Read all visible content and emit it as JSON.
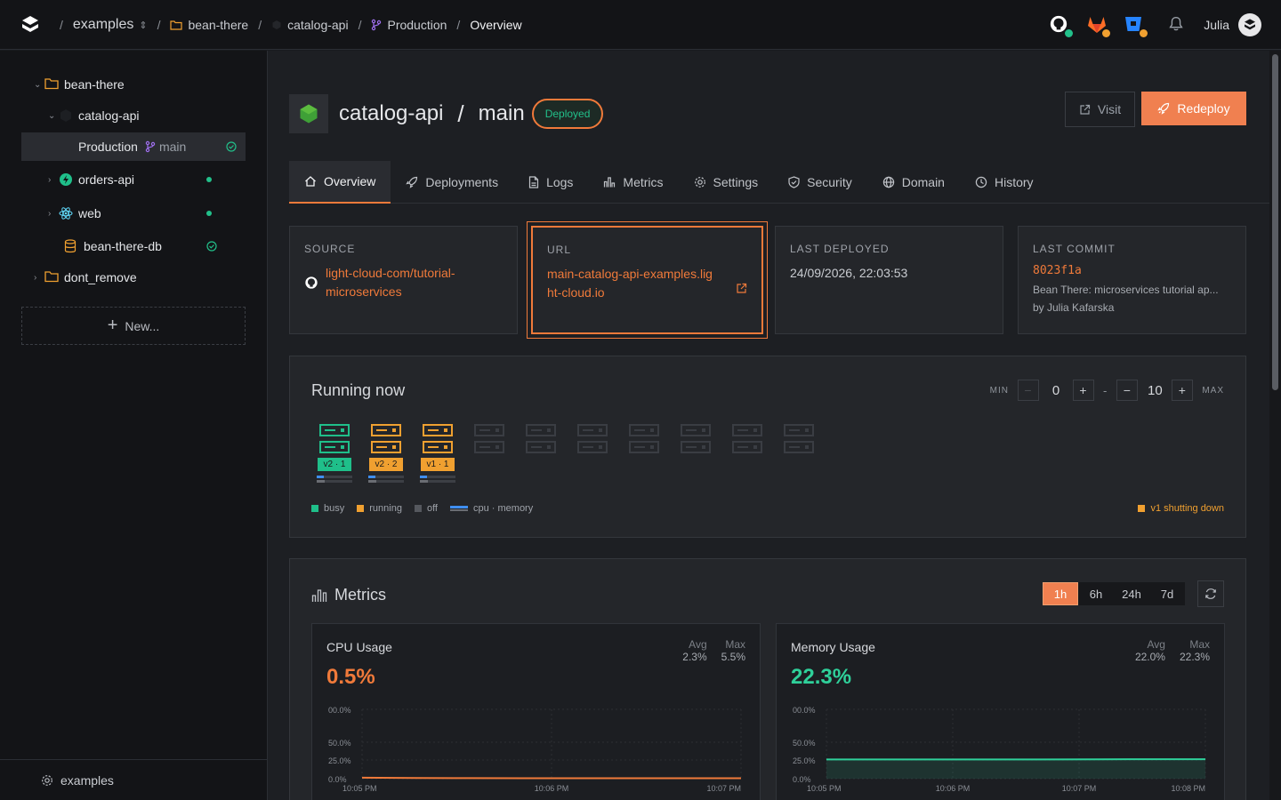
{
  "topbar": {
    "crumbs": [
      {
        "label": "examples"
      },
      {
        "label": "bean-there"
      },
      {
        "label": "catalog-api"
      },
      {
        "label": "Production"
      },
      {
        "label": "Overview"
      }
    ],
    "user_name": "Julia"
  },
  "sidebar": {
    "items": [
      {
        "label": "bean-there"
      },
      {
        "label": "catalog-api"
      },
      {
        "label": "Production",
        "branch": "main"
      },
      {
        "label": "orders-api"
      },
      {
        "label": "web"
      },
      {
        "label": "bean-there-db"
      },
      {
        "label": "dont_remove"
      }
    ],
    "new_label": "New...",
    "footer_label": "examples"
  },
  "header": {
    "service": "catalog-api",
    "branch": "main",
    "status": "Deployed",
    "visit_label": "Visit",
    "redeploy_label": "Redeploy"
  },
  "tabs": [
    {
      "label": "Overview"
    },
    {
      "label": "Deployments"
    },
    {
      "label": "Logs"
    },
    {
      "label": "Metrics"
    },
    {
      "label": "Settings"
    },
    {
      "label": "Security"
    },
    {
      "label": "Domain"
    },
    {
      "label": "History"
    }
  ],
  "cards": {
    "source": {
      "label": "SOURCE",
      "line1": "light-cloud-com/tutorial-",
      "line2": "microservices"
    },
    "url": {
      "label": "URL",
      "line1": "main-catalog-api-examples.lig",
      "line2": "ht-cloud.io"
    },
    "deployed": {
      "label": "LAST DEPLOYED",
      "value": "24/09/2026, 22:03:53"
    },
    "commit": {
      "label": "LAST COMMIT",
      "hash": "8023f1a",
      "message": "Bean There: microservices tutorial ap...",
      "author": "by Julia Kafarska"
    }
  },
  "running": {
    "title": "Running now",
    "min_label": "MIN",
    "max_label": "MAX",
    "min_value": "0",
    "max_value": "10",
    "dash": "-",
    "instances": [
      {
        "tag": "v2 · 1",
        "state": "busy",
        "cpu": 0.2,
        "memory": 0.22
      },
      {
        "tag": "v2 · 2",
        "state": "running",
        "cpu": 0.2,
        "memory": 0.22
      },
      {
        "tag": "v1 · 1",
        "state": "running",
        "cpu": 0.2,
        "memory": 0.22
      }
    ],
    "off_slots": 7,
    "legend": {
      "busy": "busy",
      "running": "running",
      "off": "off",
      "cpu_mem": "cpu · memory"
    },
    "shutting": "v1 shutting down",
    "colors": {
      "busy": "#1fbf8a",
      "running": "#f0a030",
      "off": "#3a3d43",
      "cpu": "#3f8ef0"
    }
  },
  "metrics": {
    "title": "Metrics",
    "ranges": [
      "1h",
      "6h",
      "24h",
      "7d"
    ],
    "active_range": "1h",
    "cpu": {
      "title": "CPU Usage",
      "value": "0.5%",
      "avg_label": "Avg",
      "avg": "2.3%",
      "max_label": "Max",
      "max": "5.5%",
      "y_ticks": [
        "00.0%",
        "50.0%",
        "25.0%",
        "0.0%"
      ],
      "x_ticks": [
        "10:05 PM",
        "10:06 PM",
        "10:07 PM"
      ],
      "series": [
        1.1,
        0.8,
        0.6,
        0.5,
        0.5,
        0.5,
        0.5,
        0.5
      ],
      "color": "#f07a3a"
    },
    "memory": {
      "title": "Memory Usage",
      "value": "22.3%",
      "avg_label": "Avg",
      "avg": "22.0%",
      "max_label": "Max",
      "max": "22.3%",
      "y_ticks": [
        "00.0%",
        "50.0%",
        "25.0%",
        "0.0%"
      ],
      "x_ticks": [
        "10:05 PM",
        "10:06 PM",
        "10:07 PM",
        "10:08 PM"
      ],
      "series": [
        22.0,
        22.0,
        22.0,
        22.0,
        22.0,
        22.1,
        22.3,
        22.3
      ],
      "color": "#2fd09a"
    }
  }
}
